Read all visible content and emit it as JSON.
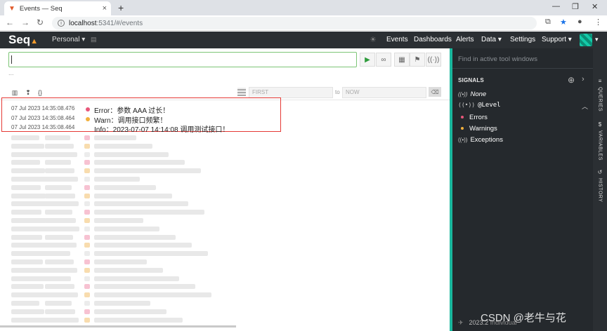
{
  "browser": {
    "tab_title": "Events — Seq",
    "tab_close": "×",
    "new_tab": "+",
    "url_host": "localhost",
    "url_path": ":5341/#/events"
  },
  "seq": {
    "logo": "Seq",
    "workspace": "Personal",
    "nav": [
      "Events",
      "Dashboards",
      "Alerts",
      "Data",
      "Settings",
      "Support"
    ]
  },
  "main": {
    "ellipsis": "...",
    "from_placeholder": "FIRST",
    "to_label": "to",
    "to_placeholder": "NOW"
  },
  "events": [
    {
      "timestamp": "07 Jul 2023  14:35:08.476",
      "level": "error",
      "message": "Error：参数 AAA 过长！",
      "color": "#e8577a"
    },
    {
      "timestamp": "07 Jul 2023  14:35:08.464",
      "level": "warning",
      "message": "Warn：调用接口频繁！",
      "color": "#f2b03c"
    },
    {
      "timestamp": "07 Jul 2023  14:35:08.464",
      "level": "info",
      "message": "Info：2023-07-07 14:14:08 调用测试接口！",
      "color": "transparent"
    }
  ],
  "side": {
    "find_placeholder": "Find in active tool windows",
    "signals_title": "SIGNALS",
    "none_label": "None",
    "level_label": "@Level",
    "errors_label": "Errors",
    "warnings_label": "Warnings",
    "exceptions_label": "Exceptions",
    "version": "2023.2",
    "version_suffix": "Individual"
  },
  "vtabs": [
    "QUERIES",
    "VARIABLES",
    "HISTORY"
  ],
  "watermark": "CSDN @老牛与花"
}
